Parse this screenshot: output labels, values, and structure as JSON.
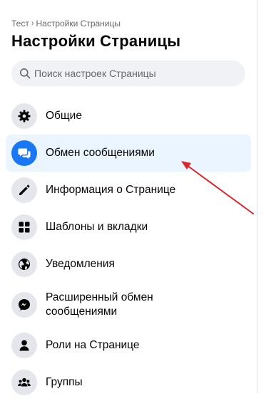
{
  "breadcrumb": {
    "parent": "Тест",
    "separator": "›",
    "current": "Настройки Страницы"
  },
  "page_title": "Настройки Страницы",
  "search": {
    "placeholder": "Поиск настроек Страницы",
    "value": ""
  },
  "menu": {
    "items": [
      {
        "label": "Общие",
        "icon": "gear-icon",
        "active": false
      },
      {
        "label": "Обмен сообщениями",
        "icon": "chat-bubbles-icon",
        "active": true
      },
      {
        "label": "Информация о Странице",
        "icon": "pencil-icon",
        "active": false
      },
      {
        "label": "Шаблоны и вкладки",
        "icon": "grid-icon",
        "active": false
      },
      {
        "label": "Уведомления",
        "icon": "globe-icon",
        "active": false
      },
      {
        "label": "Расширенный обмен сообщениями",
        "icon": "messenger-icon",
        "active": false
      },
      {
        "label": "Роли на Странице",
        "icon": "person-icon",
        "active": false
      },
      {
        "label": "Группы",
        "icon": "people-group-icon",
        "active": false
      }
    ]
  },
  "colors": {
    "accent": "#1877f2",
    "active_bg": "#ebf5ff",
    "icon_bg": "#e4e6eb",
    "annotation_arrow": "#d7262c"
  }
}
